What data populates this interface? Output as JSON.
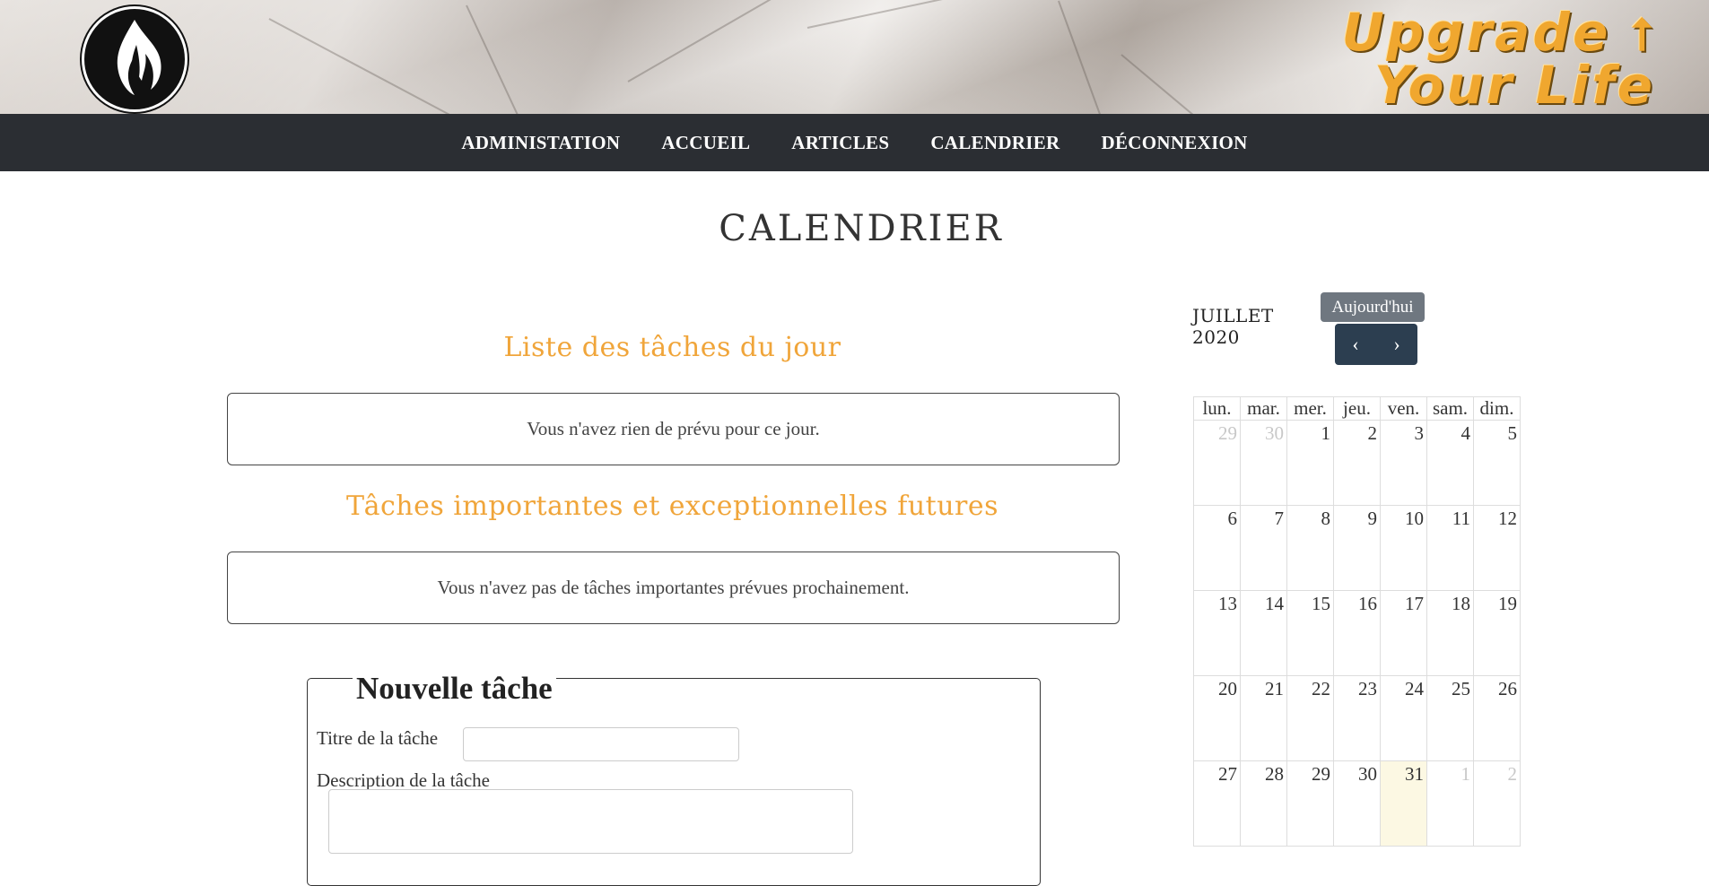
{
  "brand": {
    "line1": "Upgrade",
    "line2": "Your Life",
    "arrow": "⭡"
  },
  "nav": {
    "items": [
      "ADMINISTATION",
      "ACCUEIL",
      "ARTICLES",
      "CALENDRIER",
      "DÉCONNEXION"
    ]
  },
  "page": {
    "title": "CALENDRIER"
  },
  "today_tasks": {
    "title": "Liste des tâches du jour",
    "empty": "Vous n'avez rien de prévu pour ce jour."
  },
  "future_tasks": {
    "title": "Tâches importantes et exceptionnelles futures",
    "empty": "Vous n'avez pas de tâches importantes prévues prochainement."
  },
  "new_task": {
    "legend": "Nouvelle tâche",
    "title_label": "Titre de la tâche",
    "description_label": "Description de la tâche"
  },
  "calendar": {
    "month": "JUILLET",
    "year": "2020",
    "today_label": "Aujourd'hui",
    "prev_symbol": "‹",
    "next_symbol": "›",
    "weekdays": [
      "lun.",
      "mar.",
      "mer.",
      "jeu.",
      "ven.",
      "sam.",
      "dim."
    ],
    "weeks": [
      [
        "29",
        "30",
        "1",
        "2",
        "3",
        "4",
        "5"
      ],
      [
        "6",
        "7",
        "8",
        "9",
        "10",
        "11",
        "12"
      ],
      [
        "13",
        "14",
        "15",
        "16",
        "17",
        "18",
        "19"
      ],
      [
        "20",
        "21",
        "22",
        "23",
        "24",
        "25",
        "26"
      ],
      [
        "27",
        "28",
        "29",
        "30",
        "31",
        "1",
        "2"
      ]
    ],
    "other_month": [
      [
        0,
        0
      ],
      [
        0,
        1
      ],
      [
        4,
        5
      ],
      [
        4,
        6
      ]
    ],
    "today": [
      4,
      4
    ]
  }
}
